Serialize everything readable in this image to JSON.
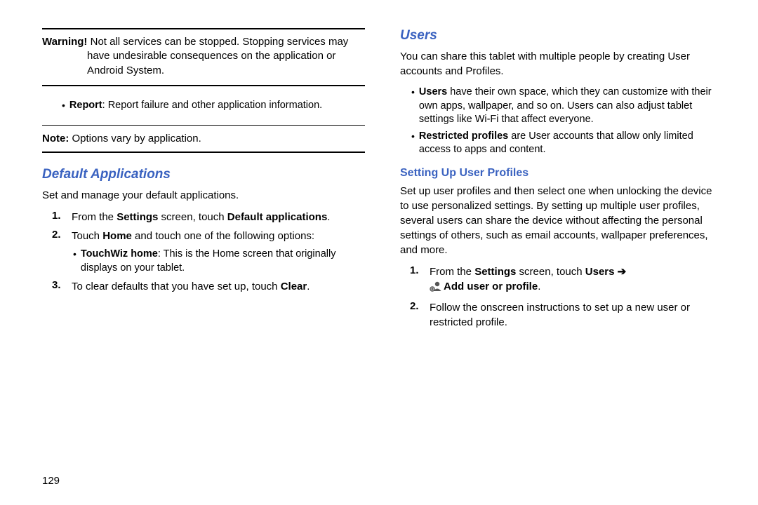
{
  "left": {
    "warning": {
      "label": "Warning!",
      "text": "Not all services can be stopped. Stopping services may have undesirable consequences on the application or Android System."
    },
    "report": {
      "label": "Report",
      "text": ": Report failure and other application information."
    },
    "note": {
      "label": "Note:",
      "text": " Options vary by application."
    },
    "heading": "Default Applications",
    "intro": "Set and manage your default applications.",
    "step1_pre": "From the ",
    "step1_b1": "Settings",
    "step1_mid": " screen, touch ",
    "step1_b2": "Default applications",
    "step1_post": ".",
    "step2_pre": "Touch ",
    "step2_b1": "Home",
    "step2_post": " and touch one of the following options:",
    "step2_bullet_b": "TouchWiz home",
    "step2_bullet_t": ": This is the Home screen that originally displays on your tablet.",
    "step3_pre": "To clear defaults that you have set up, touch ",
    "step3_b1": "Clear",
    "step3_post": "."
  },
  "right": {
    "heading": "Users",
    "intro": "You can share this tablet with multiple people by creating User accounts and Profiles.",
    "b1_label": "Users",
    "b1_text": " have their own space, which they can customize with their own apps, wallpaper, and so on. Users can also adjust tablet settings like Wi-Fi that affect everyone.",
    "b2_label": "Restricted profiles",
    "b2_text": " are User accounts that allow only limited access to apps and content.",
    "sub_heading": "Setting Up User Profiles",
    "sub_intro": "Set up user profiles and then select one when unlocking the device to use personalized settings. By setting up multiple user profiles, several users can share the device without affecting the personal settings of others, such as email accounts, wallpaper preferences, and more.",
    "step1_pre": "From the ",
    "step1_b1": "Settings",
    "step1_mid": " screen, touch ",
    "step1_b2": "Users",
    "step1_arrow": " ➔",
    "step1_b3": "Add user or profile",
    "step1_post": ".",
    "step2": "Follow the onscreen instructions to set up a new user or restricted profile."
  },
  "page_number": "129"
}
